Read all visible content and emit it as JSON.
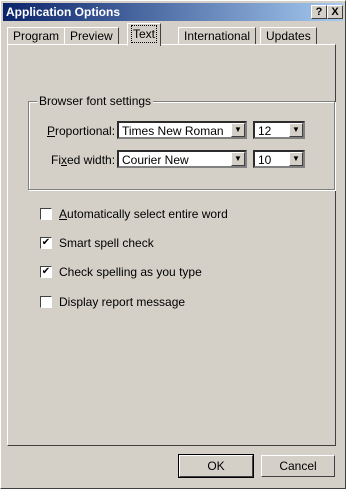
{
  "window": {
    "title": "Application Options",
    "help_label": "?",
    "close_label": "X"
  },
  "tabs": [
    {
      "label": "Program"
    },
    {
      "label": "Preview"
    },
    {
      "label": "Text",
      "active": true
    },
    {
      "label": "International"
    },
    {
      "label": "Updates"
    }
  ],
  "browser_fonts": {
    "group_label": "Browser font settings",
    "proportional": {
      "label_pre": "",
      "label_key": "P",
      "label_post": "roportional:",
      "font": "Times New Roman",
      "size": "12"
    },
    "fixed": {
      "label_pre": "Fi",
      "label_key": "x",
      "label_post": "ed width:",
      "font": "Courier New",
      "size": "10"
    }
  },
  "options": [
    {
      "key": "A",
      "rest": "utomatically select entire word",
      "checked": false
    },
    {
      "key": "",
      "rest": "Smart spell check",
      "checked": true
    },
    {
      "key": "",
      "rest": "Check spelling as you type",
      "checked": true
    },
    {
      "key": "",
      "rest": "Display report message",
      "checked": false
    }
  ],
  "buttons": {
    "ok": "OK",
    "cancel": "Cancel"
  }
}
